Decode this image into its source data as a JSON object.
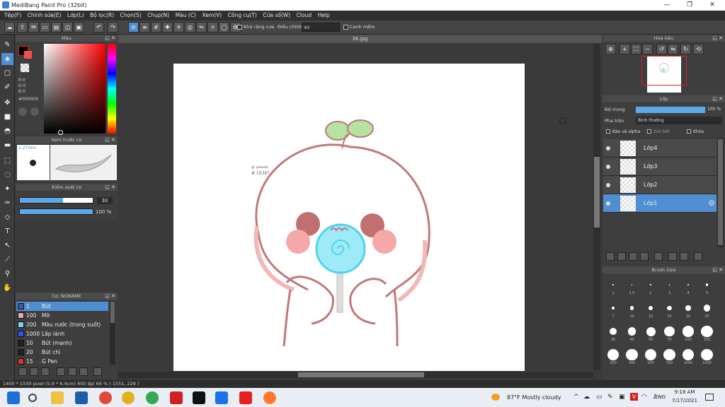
{
  "window": {
    "title": "MediBang Paint Pro (32bit)"
  },
  "menu": [
    "Tệp(F)",
    "Chỉnh sửa(E)",
    "Lớp(L)",
    "Bộ lọc(R)",
    "Chọn(S)",
    "Chụp(N)",
    "Màu (C)",
    "Xem(V)",
    "Công cụ(T)",
    "Cửa sổ(W)",
    "Cloud",
    "Help"
  ],
  "toolbar": {
    "antialias_label": "Khử răng cưa",
    "adjust_label": "Điều chỉnh",
    "adjust_value": "40",
    "snap_label": "Canh mềm"
  },
  "color_panel": {
    "title": "Màu",
    "r": "R:0",
    "g": "G:0",
    "b": "B:0",
    "hex": "#000000",
    "primary_color": "#000000",
    "accent_color": "#e02020"
  },
  "brush_preview": {
    "title": "Xem trước cọ",
    "size_label": "1.27mm"
  },
  "brush_control": {
    "title": "Kiểm soát cọ",
    "size_value": "30",
    "opacity_value": "100 %",
    "size_fraction": 0.59,
    "opacity_fraction": 1.0
  },
  "brush_list": {
    "title": "Cọ: NONAME",
    "items": [
      {
        "num": "1",
        "name": "Bút",
        "color": "#2d5fa0"
      },
      {
        "num": "100",
        "name": "Mờ",
        "color": "#f4a0c0"
      },
      {
        "num": "200",
        "name": "Màu nước (trong suốt)",
        "color": "#7fd0f0"
      },
      {
        "num": "1000",
        "name": "Lấp lánh",
        "color": "#3050ff"
      },
      {
        "num": "10",
        "name": "Bút (mạnh)",
        "color": "#222222"
      },
      {
        "num": "20",
        "name": "Bút chì",
        "color": "#222222"
      },
      {
        "num": "15",
        "name": "G Pen",
        "color": "#e03030"
      }
    ]
  },
  "document": {
    "tab": "36.jpg"
  },
  "navigator": {
    "title": "Hoa tiêu"
  },
  "layers": {
    "title": "Lớp",
    "opacity_label": "Độ trong",
    "opacity_value": "100 %",
    "blend_label": "Pha trộn",
    "blend_value": "Bình thường",
    "protect_alpha": "Bảo vệ alpha",
    "clip": "Xén bớt",
    "lock": "Khóa",
    "items": [
      {
        "name": "Lớp4"
      },
      {
        "name": "Lớp3"
      },
      {
        "name": "Lớp2"
      },
      {
        "name": "Lớp1"
      }
    ]
  },
  "brush_size": {
    "title": "Brush Size",
    "sizes": [
      "1",
      "1.5",
      "2",
      "3",
      "4",
      "5",
      "7",
      "10",
      "12",
      "15",
      "20",
      "25",
      "30",
      "40",
      "50",
      "70",
      "100",
      "150",
      "200",
      "300",
      "500",
      "700",
      "1000",
      "1000"
    ]
  },
  "drawing_text": {
    "line1": "@ yhindu",
    "line2": "# 1034?"
  },
  "status": {
    "text": "1400 * 1500 pixel    (5.9 * 6.4cm)  600 dpi   66 %   ( 1551, 228 )"
  },
  "taskbar": {
    "weather": "87°F  Mostly cloudy",
    "lang": "ENG",
    "time": "9:18 AM",
    "date": "7/17/2021"
  }
}
